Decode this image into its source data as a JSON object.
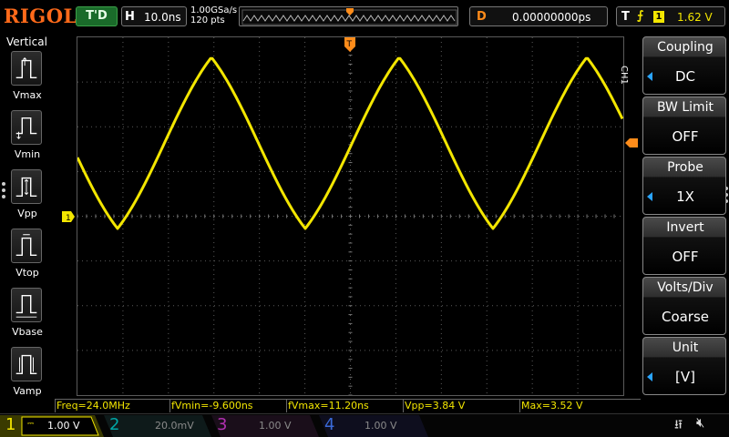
{
  "top_bar": {
    "brand": "RIGOL",
    "run_status": "T'D",
    "horizontal": {
      "label": "H",
      "timebase": "10.0ns"
    },
    "sample_rate": "1.00GSa/s",
    "memory_depth": "120 pts",
    "delay": {
      "label": "D",
      "value": "0.00000000ps"
    },
    "trigger": {
      "label": "T",
      "edge_icon": "rising-edge-icon",
      "source": "1",
      "level": "1.62 V"
    }
  },
  "left_panel": {
    "title": "Vertical",
    "measurements": [
      {
        "label": "Vmax",
        "icon": "vmax-icon"
      },
      {
        "label": "Vmin",
        "icon": "vmin-icon"
      },
      {
        "label": "Vpp",
        "icon": "vpp-icon"
      },
      {
        "label": "Vtop",
        "icon": "vtop-icon"
      },
      {
        "label": "Vbase",
        "icon": "vbase-icon"
      },
      {
        "label": "Vamp",
        "icon": "vamp-icon"
      }
    ]
  },
  "right_menu": {
    "channel_tab": "CH1",
    "items": [
      {
        "title": "Coupling",
        "value": "DC"
      },
      {
        "title": "BW Limit",
        "value": "OFF"
      },
      {
        "title": "Probe",
        "value": "1X"
      },
      {
        "title": "Invert",
        "value": "OFF"
      },
      {
        "title": "Volts/Div",
        "value": "Coarse"
      },
      {
        "title": "Unit",
        "value": "[V]"
      }
    ]
  },
  "markers": {
    "ch1_ground": "1",
    "trigger_position": "T"
  },
  "readouts": [
    "Freq=24.0MHz",
    "fVmin=-9.600ns",
    "fVmax=11.20ns",
    "Vpp=3.84 V",
    "Max=3.52 V"
  ],
  "channels": [
    {
      "number": "1",
      "scale": "1.00 V",
      "color": "#f3e600"
    },
    {
      "number": "2",
      "scale": "20.0mV",
      "color": "#00c8c8"
    },
    {
      "number": "3",
      "scale": "1.00 V",
      "color": "#d040d0"
    },
    {
      "number": "4",
      "scale": "1.00 V",
      "color": "#3a78ff"
    }
  ],
  "colors": {
    "ch1": "#f3e600",
    "brand": "#ff6a1a",
    "marker": "#ff8c1a",
    "accent": "#2aa5ff",
    "grid": "#5a5a5a"
  },
  "waveform": {
    "shape": "triangle-sine",
    "frequency_label": "24.0MHz",
    "peaks_visible": 3
  }
}
